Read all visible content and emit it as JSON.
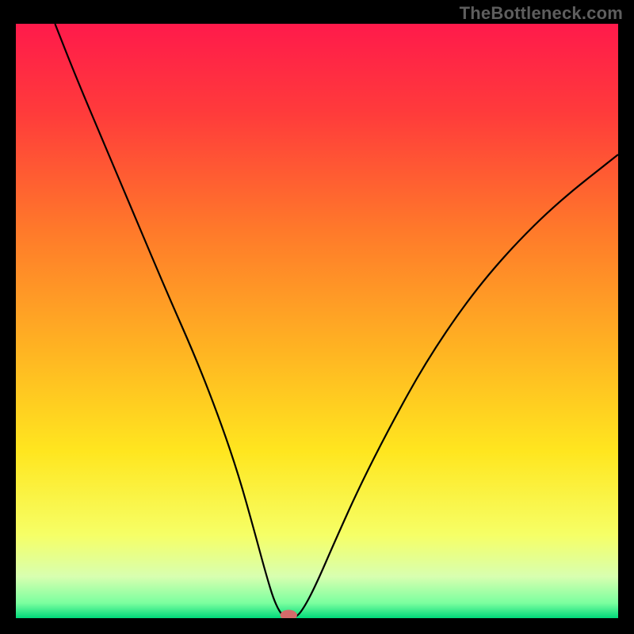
{
  "watermark": "TheBottleneck.com",
  "chart_data": {
    "type": "line",
    "title": "",
    "xlabel": "",
    "ylabel": "",
    "xlim": [
      0,
      100
    ],
    "ylim": [
      0,
      100
    ],
    "grid": false,
    "legend": false,
    "gradient_stops": [
      {
        "offset": 0.0,
        "color": "#ff1a4b"
      },
      {
        "offset": 0.15,
        "color": "#ff3b3b"
      },
      {
        "offset": 0.35,
        "color": "#ff7a2a"
      },
      {
        "offset": 0.55,
        "color": "#ffb422"
      },
      {
        "offset": 0.72,
        "color": "#ffe61f"
      },
      {
        "offset": 0.86,
        "color": "#f6ff66"
      },
      {
        "offset": 0.93,
        "color": "#d8ffb0"
      },
      {
        "offset": 0.975,
        "color": "#7aff9f"
      },
      {
        "offset": 1.0,
        "color": "#00d97a"
      }
    ],
    "series": [
      {
        "name": "bottleneck-curve",
        "color": "#000000",
        "points": [
          {
            "x": 6.5,
            "y": 100.0
          },
          {
            "x": 10.0,
            "y": 91.0
          },
          {
            "x": 15.0,
            "y": 79.0
          },
          {
            "x": 20.0,
            "y": 67.0
          },
          {
            "x": 25.0,
            "y": 55.0
          },
          {
            "x": 30.0,
            "y": 43.5
          },
          {
            "x": 34.0,
            "y": 33.0
          },
          {
            "x": 37.0,
            "y": 24.0
          },
          {
            "x": 39.5,
            "y": 15.0
          },
          {
            "x": 41.5,
            "y": 7.5
          },
          {
            "x": 43.0,
            "y": 2.5
          },
          {
            "x": 44.5,
            "y": 0.0
          },
          {
            "x": 46.5,
            "y": 0.0
          },
          {
            "x": 48.0,
            "y": 2.0
          },
          {
            "x": 50.0,
            "y": 6.0
          },
          {
            "x": 53.0,
            "y": 13.0
          },
          {
            "x": 57.0,
            "y": 22.0
          },
          {
            "x": 62.0,
            "y": 32.0
          },
          {
            "x": 68.0,
            "y": 43.0
          },
          {
            "x": 75.0,
            "y": 53.5
          },
          {
            "x": 82.0,
            "y": 62.0
          },
          {
            "x": 90.0,
            "y": 70.0
          },
          {
            "x": 100.0,
            "y": 78.0
          }
        ]
      }
    ],
    "marker": {
      "name": "selected-point",
      "x": 45.3,
      "y": 0.5,
      "color": "#d46a6a",
      "rx": 1.4,
      "ry": 0.9
    }
  }
}
